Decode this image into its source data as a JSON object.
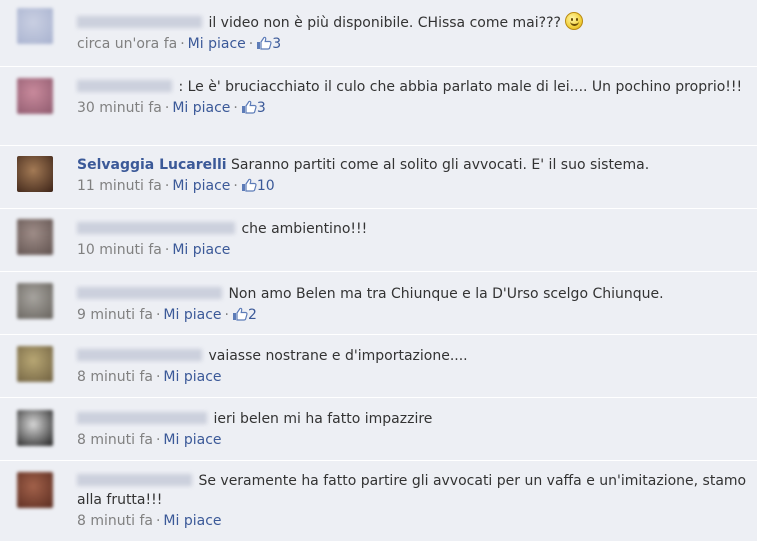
{
  "comments": [
    {
      "author_blurred": true,
      "author": "",
      "text": "il video non è più disponibile. CHissa come mai???",
      "has_smiley": true,
      "time": "circa un'ora fa",
      "like": "Mi piace",
      "likes": "3",
      "avatar_colors": [
        "#c9cfe2",
        "#a8b2cf"
      ]
    },
    {
      "author_blurred": true,
      "author": "",
      "text": ": Le è' bruciacchiato il culo che abbia parlato male di lei.... Un pochino proprio!!!",
      "has_smiley": false,
      "time": "30 minuti fa",
      "like": "Mi piace",
      "likes": "3",
      "avatar_colors": [
        "#c98a9c",
        "#8e5a6e"
      ]
    },
    {
      "author_blurred": false,
      "author": "Selvaggia Lucarelli",
      "text": "Saranno partiti come al solito gli avvocati. E' il suo sistema.",
      "has_smiley": false,
      "time": "11 minuti fa",
      "like": "Mi piace",
      "likes": "10",
      "avatar_colors": [
        "#a37a55",
        "#3d2418"
      ]
    },
    {
      "author_blurred": true,
      "author": "",
      "text": "che ambientino!!!",
      "has_smiley": false,
      "time": "10 minuti fa",
      "like": "Mi piace",
      "likes": "",
      "avatar_colors": [
        "#9f8d88",
        "#5f514e"
      ]
    },
    {
      "author_blurred": true,
      "author": "",
      "text": "Non amo Belen ma tra Chiunque e la D'Urso scelgo Chiunque.",
      "has_smiley": false,
      "time": "9 minuti fa",
      "like": "Mi piace",
      "likes": "2",
      "avatar_colors": [
        "#a7a49f",
        "#66625c"
      ]
    },
    {
      "author_blurred": true,
      "author": "",
      "text": "vaiasse nostrane e d'importazione....",
      "has_smiley": false,
      "time": "8 minuti fa",
      "like": "Mi piace",
      "likes": "",
      "avatar_colors": [
        "#b8a774",
        "#6f6040"
      ]
    },
    {
      "author_blurred": true,
      "author": "",
      "text": "ieri belen mi ha fatto impazzire",
      "has_smiley": false,
      "time": "8 minuti fa",
      "like": "Mi piace",
      "likes": "",
      "avatar_colors": [
        "#d6d6d6",
        "#1f1f1f"
      ]
    },
    {
      "author_blurred": true,
      "author": "",
      "text": "Se veramente ha fatto partire gli avvocati per un vaffa e un'imitazione, stamo alla frutta!!!",
      "has_smiley": false,
      "time": "8 minuti fa",
      "like": "Mi piace",
      "likes": "",
      "avatar_colors": [
        "#a2614a",
        "#5a2c20"
      ]
    }
  ],
  "colors": {
    "background": "#edeff4",
    "link": "#3b5998",
    "meta": "#808080"
  }
}
